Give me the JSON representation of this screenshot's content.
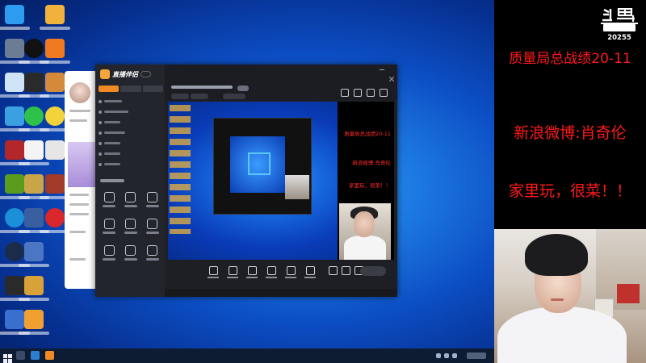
{
  "window": {
    "app_name": "直播伴侣"
  },
  "overlay": {
    "lines": [
      {
        "text": "质量局总战绩20-11"
      },
      {
        "text": "新浪微博:肖奇伦"
      },
      {
        "text": "家里玩，很菜！！"
      }
    ],
    "room_number": "20255"
  },
  "preview": {
    "overlay_lines": [
      "质量局总战绩20-11",
      "新浪微博:肖奇伦",
      "家里玩，很菜！！"
    ]
  },
  "colors": {
    "overlay_text": "#ff1a1a",
    "brand_orange": "#f08a24",
    "app_bg": "#1d1f25"
  },
  "icons": {
    "logo": "douyu-logo",
    "brand": "live-companion-icon",
    "windows_start": "windows-start-icon"
  }
}
